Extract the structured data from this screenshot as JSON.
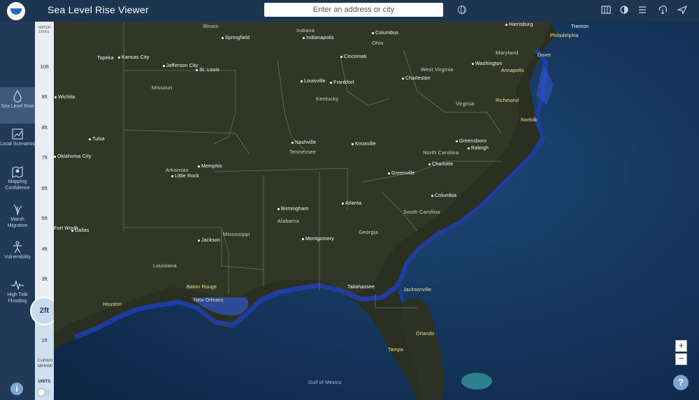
{
  "header": {
    "title": "Sea Level Rise Viewer",
    "search_placeholder": "Enter an address or city",
    "icons": [
      "globe-icon",
      "map-icon",
      "contrast-icon",
      "legend-icon",
      "download-icon",
      "share-icon"
    ]
  },
  "sidebar": {
    "items": [
      {
        "label": "Sea Level Rise",
        "icon": "water-drop-icon",
        "active": true
      },
      {
        "label": "Local Scenarios",
        "icon": "chart-icon",
        "active": false
      },
      {
        "label": "Mapping Confidence",
        "icon": "map-pin-icon",
        "active": false
      },
      {
        "label": "Marsh Migration",
        "icon": "marsh-grass-icon",
        "active": false
      },
      {
        "label": "Vulnerability",
        "icon": "person-icon",
        "active": false
      },
      {
        "label": "High Tide Flooding",
        "icon": "pulse-icon",
        "active": false
      }
    ],
    "info_label": "i"
  },
  "water_level": {
    "title": "WATER LEVEL",
    "ticks": [
      "10ft",
      "9ft",
      "8ft",
      "7ft",
      "6ft",
      "5ft",
      "4ft",
      "3ft",
      "2ft",
      "1ft"
    ],
    "current_label": "Current MHHW",
    "selected": "2ft",
    "selected_value_ft": 2,
    "units_label": "UNITS"
  },
  "map": {
    "states": [
      "Illinois",
      "Indiana",
      "Ohio",
      "Missouri",
      "Kentucky",
      "West Virginia",
      "Virginia",
      "Tennessee",
      "North Carolina",
      "South Carolina",
      "Georgia",
      "Alabama",
      "Mississippi",
      "Louisiana",
      "Arkansas",
      "Maryland"
    ],
    "cities": [
      "Springfield",
      "Indianapolis",
      "Columbus",
      "Cincinnati",
      "Topeka",
      "Kansas City",
      "Jefferson City",
      "St. Louis",
      "Louisville",
      "Frankfort",
      "Charleston",
      "Washington",
      "Annapolis",
      "Richmond",
      "Norfolk",
      "Nashville",
      "Knoxville",
      "Greensboro",
      "Raleigh",
      "Charlotte",
      "Greenville",
      "Columbia",
      "Tulsa",
      "Oklahoma City",
      "Memphis",
      "Little Rock",
      "Birmingham",
      "Atlanta",
      "Montgomery",
      "Jackson",
      "Dallas",
      "Fort Worth",
      "Baton Rouge",
      "New Orleans",
      "Houston",
      "Tallahassee",
      "Jacksonville",
      "Orlando",
      "Tampa",
      "Trenton",
      "Philadelphia",
      "Dover",
      "Harrisburg",
      "Wichita",
      "Gulf of Mexico"
    ]
  },
  "controls": {
    "zoom_in": "+",
    "zoom_out": "−",
    "help": "?"
  }
}
